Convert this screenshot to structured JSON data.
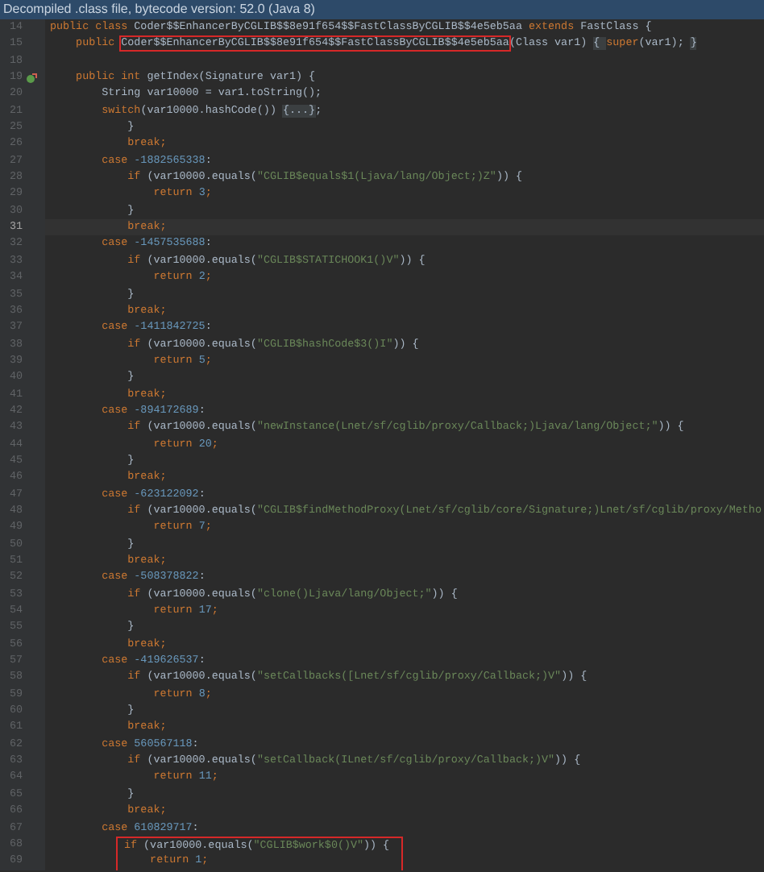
{
  "banner": "Decompiled .class file, bytecode version: 52.0 (Java 8)",
  "lines": [
    {
      "number": "14",
      "current": false,
      "boxed": false,
      "marked": false,
      "segments": [
        {
          "kind": "kw",
          "text": "public class "
        },
        {
          "kind": "plain",
          "text": "Coder$$EnhancerByCGLIB$$8e91f654$$FastClassByCGLIB$$4e5eb5aa "
        },
        {
          "kind": "kw",
          "text": "extends "
        },
        {
          "kind": "plain",
          "text": "FastClass {"
        }
      ]
    },
    {
      "number": "15",
      "current": false,
      "boxed": false,
      "marked": false,
      "segments": [
        {
          "kind": "kw",
          "text": "    public "
        },
        {
          "kind": "boxed",
          "text": "Coder$$EnhancerByCGLIB$$8e91f654$$FastClassByCGLIB$$4e5eb5aa"
        },
        {
          "kind": "plain",
          "text": "(Class var1) "
        },
        {
          "kind": "fold",
          "text": "{ "
        },
        {
          "kind": "kw",
          "text": "super"
        },
        {
          "kind": "plain",
          "text": "(var1); "
        },
        {
          "kind": "fold",
          "text": "}"
        }
      ]
    },
    {
      "number": "18",
      "current": false,
      "boxed": false,
      "marked": false
    },
    {
      "number": "19",
      "current": false,
      "boxed": false,
      "marked": true,
      "segments": [
        {
          "kind": "kw",
          "text": "    public int "
        },
        {
          "kind": "plain",
          "text": "getIndex(Signature var1) {"
        }
      ]
    },
    {
      "number": "20",
      "current": false,
      "boxed": false,
      "marked": false,
      "segments": [
        {
          "kind": "plain",
          "text": "        String var10000 = var1.toString();"
        }
      ]
    },
    {
      "number": "21",
      "current": false,
      "boxed": false,
      "marked": false,
      "segments": [
        {
          "kind": "kw",
          "text": "        switch"
        },
        {
          "kind": "plain",
          "text": "(var10000.hashCode()) "
        },
        {
          "kind": "fold",
          "text": "{...}"
        },
        {
          "kind": "plain",
          "text": ";"
        }
      ]
    },
    {
      "number": "25",
      "current": false,
      "boxed": false,
      "marked": false,
      "segments": [
        {
          "kind": "plain",
          "text": "            }"
        }
      ]
    },
    {
      "number": "26",
      "current": false,
      "boxed": false,
      "marked": false,
      "segments": [
        {
          "kind": "kw",
          "text": "            break;"
        }
      ]
    },
    {
      "number": "27",
      "current": false,
      "boxed": false,
      "marked": false,
      "segments": [
        {
          "kind": "kw",
          "text": "        case "
        },
        {
          "kind": "num",
          "text": "-1882565338"
        },
        {
          "kind": "plain",
          "text": ":"
        }
      ]
    },
    {
      "number": "28",
      "current": false,
      "boxed": false,
      "marked": false,
      "segments": [
        {
          "kind": "kw",
          "text": "            if "
        },
        {
          "kind": "plain",
          "text": "(var10000.equals("
        },
        {
          "kind": "str",
          "text": "\"CGLIB$equals$1(Ljava/lang/Object;)Z\""
        },
        {
          "kind": "plain",
          "text": ")) {"
        }
      ]
    },
    {
      "number": "29",
      "current": false,
      "boxed": false,
      "marked": false,
      "segments": [
        {
          "kind": "kw",
          "text": "                return "
        },
        {
          "kind": "num",
          "text": "3"
        },
        {
          "kind": "kw",
          "text": ";"
        }
      ]
    },
    {
      "number": "30",
      "current": false,
      "boxed": false,
      "marked": false,
      "segments": [
        {
          "kind": "plain",
          "text": "            }"
        }
      ]
    },
    {
      "number": "31",
      "current": true,
      "boxed": false,
      "marked": false,
      "segments": [
        {
          "kind": "kw",
          "text": "            break;"
        }
      ]
    },
    {
      "number": "32",
      "current": false,
      "boxed": false,
      "marked": false,
      "segments": [
        {
          "kind": "kw",
          "text": "        case "
        },
        {
          "kind": "num",
          "text": "-1457535688"
        },
        {
          "kind": "plain",
          "text": ":"
        }
      ]
    },
    {
      "number": "33",
      "current": false,
      "boxed": false,
      "marked": false,
      "segments": [
        {
          "kind": "kw",
          "text": "            if "
        },
        {
          "kind": "plain",
          "text": "(var10000.equals("
        },
        {
          "kind": "str",
          "text": "\"CGLIB$STATICHOOK1()V\""
        },
        {
          "kind": "plain",
          "text": ")) {"
        }
      ]
    },
    {
      "number": "34",
      "current": false,
      "boxed": false,
      "marked": false,
      "segments": [
        {
          "kind": "kw",
          "text": "                return "
        },
        {
          "kind": "num",
          "text": "2"
        },
        {
          "kind": "kw",
          "text": ";"
        }
      ]
    },
    {
      "number": "35",
      "current": false,
      "boxed": false,
      "marked": false,
      "segments": [
        {
          "kind": "plain",
          "text": "            }"
        }
      ]
    },
    {
      "number": "36",
      "current": false,
      "boxed": false,
      "marked": false,
      "segments": [
        {
          "kind": "kw",
          "text": "            break;"
        }
      ]
    },
    {
      "number": "37",
      "current": false,
      "boxed": false,
      "marked": false,
      "segments": [
        {
          "kind": "kw",
          "text": "        case "
        },
        {
          "kind": "num",
          "text": "-1411842725"
        },
        {
          "kind": "plain",
          "text": ":"
        }
      ]
    },
    {
      "number": "38",
      "current": false,
      "boxed": false,
      "marked": false,
      "segments": [
        {
          "kind": "kw",
          "text": "            if "
        },
        {
          "kind": "plain",
          "text": "(var10000.equals("
        },
        {
          "kind": "str",
          "text": "\"CGLIB$hashCode$3()I\""
        },
        {
          "kind": "plain",
          "text": ")) {"
        }
      ]
    },
    {
      "number": "39",
      "current": false,
      "boxed": false,
      "marked": false,
      "segments": [
        {
          "kind": "kw",
          "text": "                return "
        },
        {
          "kind": "num",
          "text": "5"
        },
        {
          "kind": "kw",
          "text": ";"
        }
      ]
    },
    {
      "number": "40",
      "current": false,
      "boxed": false,
      "marked": false,
      "segments": [
        {
          "kind": "plain",
          "text": "            }"
        }
      ]
    },
    {
      "number": "41",
      "current": false,
      "boxed": false,
      "marked": false,
      "segments": [
        {
          "kind": "kw",
          "text": "            break;"
        }
      ]
    },
    {
      "number": "42",
      "current": false,
      "boxed": false,
      "marked": false,
      "segments": [
        {
          "kind": "kw",
          "text": "        case "
        },
        {
          "kind": "num",
          "text": "-894172689"
        },
        {
          "kind": "plain",
          "text": ":"
        }
      ]
    },
    {
      "number": "43",
      "current": false,
      "boxed": false,
      "marked": false,
      "segments": [
        {
          "kind": "kw",
          "text": "            if "
        },
        {
          "kind": "plain",
          "text": "(var10000.equals("
        },
        {
          "kind": "str",
          "text": "\"newInstance(Lnet/sf/cglib/proxy/Callback;)Ljava/lang/Object;\""
        },
        {
          "kind": "plain",
          "text": ")) {"
        }
      ]
    },
    {
      "number": "44",
      "current": false,
      "boxed": false,
      "marked": false,
      "segments": [
        {
          "kind": "kw",
          "text": "                return "
        },
        {
          "kind": "num",
          "text": "20"
        },
        {
          "kind": "kw",
          "text": ";"
        }
      ]
    },
    {
      "number": "45",
      "current": false,
      "boxed": false,
      "marked": false,
      "segments": [
        {
          "kind": "plain",
          "text": "            }"
        }
      ]
    },
    {
      "number": "46",
      "current": false,
      "boxed": false,
      "marked": false,
      "segments": [
        {
          "kind": "kw",
          "text": "            break;"
        }
      ]
    },
    {
      "number": "47",
      "current": false,
      "boxed": false,
      "marked": false,
      "segments": [
        {
          "kind": "kw",
          "text": "        case "
        },
        {
          "kind": "num",
          "text": "-623122092"
        },
        {
          "kind": "plain",
          "text": ":"
        }
      ]
    },
    {
      "number": "48",
      "current": false,
      "boxed": false,
      "marked": false,
      "segments": [
        {
          "kind": "kw",
          "text": "            if "
        },
        {
          "kind": "plain",
          "text": "(var10000.equals("
        },
        {
          "kind": "str",
          "text": "\"CGLIB$findMethodProxy(Lnet/sf/cglib/core/Signature;)Lnet/sf/cglib/proxy/Metho"
        }
      ]
    },
    {
      "number": "49",
      "current": false,
      "boxed": false,
      "marked": false,
      "segments": [
        {
          "kind": "kw",
          "text": "                return "
        },
        {
          "kind": "num",
          "text": "7"
        },
        {
          "kind": "kw",
          "text": ";"
        }
      ]
    },
    {
      "number": "50",
      "current": false,
      "boxed": false,
      "marked": false,
      "segments": [
        {
          "kind": "plain",
          "text": "            }"
        }
      ]
    },
    {
      "number": "51",
      "current": false,
      "boxed": false,
      "marked": false,
      "segments": [
        {
          "kind": "kw",
          "text": "            break;"
        }
      ]
    },
    {
      "number": "52",
      "current": false,
      "boxed": false,
      "marked": false,
      "segments": [
        {
          "kind": "kw",
          "text": "        case "
        },
        {
          "kind": "num",
          "text": "-508378822"
        },
        {
          "kind": "plain",
          "text": ":"
        }
      ]
    },
    {
      "number": "53",
      "current": false,
      "boxed": false,
      "marked": false,
      "segments": [
        {
          "kind": "kw",
          "text": "            if "
        },
        {
          "kind": "plain",
          "text": "(var10000.equals("
        },
        {
          "kind": "str",
          "text": "\"clone()Ljava/lang/Object;\""
        },
        {
          "kind": "plain",
          "text": ")) {"
        }
      ]
    },
    {
      "number": "54",
      "current": false,
      "boxed": false,
      "marked": false,
      "segments": [
        {
          "kind": "kw",
          "text": "                return "
        },
        {
          "kind": "num",
          "text": "17"
        },
        {
          "kind": "kw",
          "text": ";"
        }
      ]
    },
    {
      "number": "55",
      "current": false,
      "boxed": false,
      "marked": false,
      "segments": [
        {
          "kind": "plain",
          "text": "            }"
        }
      ]
    },
    {
      "number": "56",
      "current": false,
      "boxed": false,
      "marked": false,
      "segments": [
        {
          "kind": "kw",
          "text": "            break;"
        }
      ]
    },
    {
      "number": "57",
      "current": false,
      "boxed": false,
      "marked": false,
      "segments": [
        {
          "kind": "kw",
          "text": "        case "
        },
        {
          "kind": "num",
          "text": "-419626537"
        },
        {
          "kind": "plain",
          "text": ":"
        }
      ]
    },
    {
      "number": "58",
      "current": false,
      "boxed": false,
      "marked": false,
      "segments": [
        {
          "kind": "kw",
          "text": "            if "
        },
        {
          "kind": "plain",
          "text": "(var10000.equals("
        },
        {
          "kind": "str",
          "text": "\"setCallbacks([Lnet/sf/cglib/proxy/Callback;)V\""
        },
        {
          "kind": "plain",
          "text": ")) {"
        }
      ]
    },
    {
      "number": "59",
      "current": false,
      "boxed": false,
      "marked": false,
      "segments": [
        {
          "kind": "kw",
          "text": "                return "
        },
        {
          "kind": "num",
          "text": "8"
        },
        {
          "kind": "kw",
          "text": ";"
        }
      ]
    },
    {
      "number": "60",
      "current": false,
      "boxed": false,
      "marked": false,
      "segments": [
        {
          "kind": "plain",
          "text": "            }"
        }
      ]
    },
    {
      "number": "61",
      "current": false,
      "boxed": false,
      "marked": false,
      "segments": [
        {
          "kind": "kw",
          "text": "            break;"
        }
      ]
    },
    {
      "number": "62",
      "current": false,
      "boxed": false,
      "marked": false,
      "segments": [
        {
          "kind": "kw",
          "text": "        case "
        },
        {
          "kind": "num",
          "text": "560567118"
        },
        {
          "kind": "plain",
          "text": ":"
        }
      ]
    },
    {
      "number": "63",
      "current": false,
      "boxed": false,
      "marked": false,
      "segments": [
        {
          "kind": "kw",
          "text": "            if "
        },
        {
          "kind": "plain",
          "text": "(var10000.equals("
        },
        {
          "kind": "str",
          "text": "\"setCallback(ILnet/sf/cglib/proxy/Callback;)V\""
        },
        {
          "kind": "plain",
          "text": ")) {"
        }
      ]
    },
    {
      "number": "64",
      "current": false,
      "boxed": false,
      "marked": false,
      "segments": [
        {
          "kind": "kw",
          "text": "                return "
        },
        {
          "kind": "num",
          "text": "11"
        },
        {
          "kind": "kw",
          "text": ";"
        }
      ]
    },
    {
      "number": "65",
      "current": false,
      "boxed": false,
      "marked": false,
      "segments": [
        {
          "kind": "plain",
          "text": "            }"
        }
      ]
    },
    {
      "number": "66",
      "current": false,
      "boxed": false,
      "marked": false,
      "segments": [
        {
          "kind": "kw",
          "text": "            break;"
        }
      ]
    },
    {
      "number": "67",
      "current": false,
      "boxed": false,
      "marked": false,
      "segments": [
        {
          "kind": "kw",
          "text": "        case "
        },
        {
          "kind": "num",
          "text": "610829717"
        },
        {
          "kind": "plain",
          "text": ":"
        }
      ]
    },
    {
      "number": "68",
      "current": false,
      "boxed": true,
      "marked": false,
      "segments": [
        {
          "kind": "kw",
          "text": "if "
        },
        {
          "kind": "plain",
          "text": "(var10000.equals("
        },
        {
          "kind": "str",
          "text": "\"CGLIB$work$0()V\""
        },
        {
          "kind": "plain",
          "text": ")) {"
        }
      ]
    },
    {
      "number": "69",
      "current": false,
      "boxed": true,
      "marked": false,
      "segments": [
        {
          "kind": "kw",
          "text": "    return "
        },
        {
          "kind": "num",
          "text": "1"
        },
        {
          "kind": "kw",
          "text": ";"
        }
      ]
    }
  ]
}
